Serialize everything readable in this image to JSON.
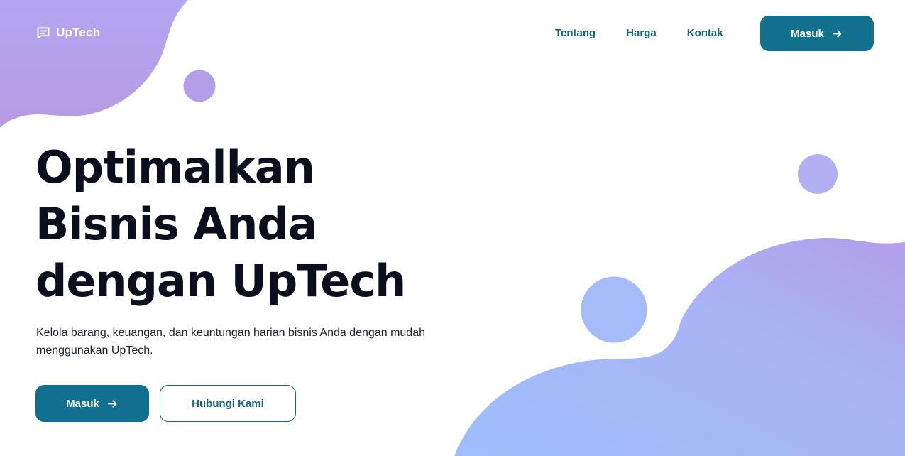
{
  "brand": {
    "name": "UpTech",
    "icon": "message-square-icon"
  },
  "nav": {
    "links": [
      {
        "label": "Tentang"
      },
      {
        "label": "Harga"
      },
      {
        "label": "Kontak"
      }
    ],
    "login_label": "Masuk",
    "login_icon": "arrow-right-icon"
  },
  "hero": {
    "title_lines": [
      "Optimalkan",
      "Bisnis Anda",
      "dengan UpTech"
    ],
    "description": "Kelola barang, keuangan, dan keuntungan harian bisnis Anda dengan mudah menggunakan UpTech.",
    "primary_cta": "Masuk",
    "primary_cta_icon": "arrow-right-icon",
    "secondary_cta": "Hubungi Kami"
  },
  "colors": {
    "primary": "#11708e",
    "nav_text": "#17657f",
    "heading": "#0a0e1d",
    "blob_purple": "#b29ee8",
    "blob_blue": "#a3bdfb"
  }
}
